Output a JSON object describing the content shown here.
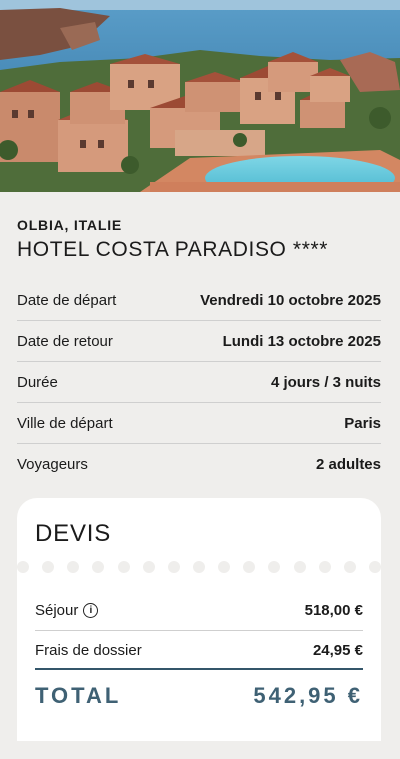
{
  "hero": {
    "alt": "hotel-photo"
  },
  "destination": {
    "location": "OLBIA, ITALIE",
    "hotel": "HOTEL COSTA PARADISO ****"
  },
  "details": [
    {
      "label": "Date de départ",
      "value": "Vendredi 10 octobre 2025"
    },
    {
      "label": "Date de retour",
      "value": "Lundi 13 octobre 2025"
    },
    {
      "label": "Durée",
      "value": "4 jours / 3 nuits"
    },
    {
      "label": "Ville de départ",
      "value": "Paris"
    },
    {
      "label": "Voyageurs",
      "value": "2 adultes"
    }
  ],
  "quote": {
    "title": "DEVIS",
    "lines": [
      {
        "label": "Séjour",
        "value": "518,00 €",
        "info_icon": "info-icon"
      },
      {
        "label": "Frais de dossier",
        "value": "24,95 €"
      }
    ],
    "total_label": "TOTAL",
    "total_value": "542,95 €"
  },
  "colors": {
    "accent": "#3f6174",
    "background": "#efeeec",
    "card": "#ffffff"
  }
}
